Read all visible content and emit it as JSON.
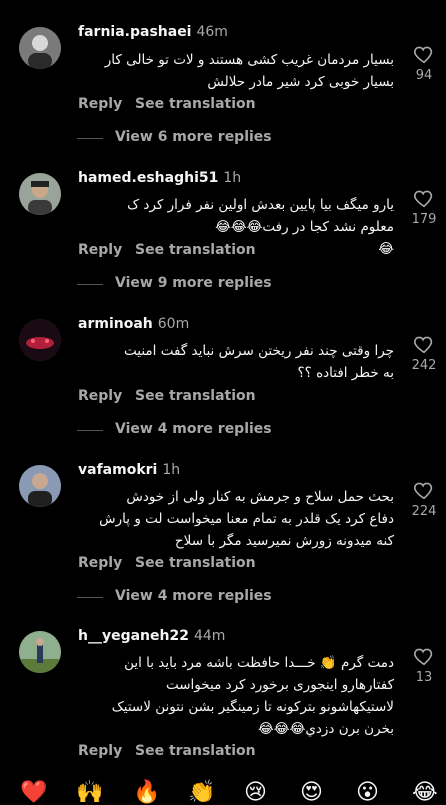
{
  "ui": {
    "reply_label": "Reply",
    "translate_label": "See translation"
  },
  "comments": [
    {
      "username": "farnia.pashaei",
      "time": "46m",
      "lines": [
        "بسیار مردمان غریب کشی هستند و لات تو خالی کار",
        "بسیار خوبی کرد شیر مادر حلالش"
      ],
      "likes": "94",
      "more_replies": "View 6 more replies",
      "avatar_color": "#6b6b6b"
    },
    {
      "username": "hamed.eshaghi51",
      "time": "1h",
      "lines": [
        "یارو میگف بیا پایین بعدش اولین نفر فرار کرد ک",
        "معلوم نشد کجا در رفت😂😂😂",
        "😂"
      ],
      "likes": "179",
      "more_replies": "View 9 more replies",
      "avatar_color": "#556655"
    },
    {
      "username": "arminoah",
      "time": "60m",
      "lines": [
        "چرا وقتی چند نفر ریختن سرش نباید گفت امنیت",
        "به خطر افتاده ؟؟"
      ],
      "likes": "242",
      "more_replies": "View 4 more replies",
      "avatar_color": "#5a1020"
    },
    {
      "username": "vafamokri",
      "time": "1h",
      "lines": [
        "بحث حمل سلاح و جرمش به کنار ولی از خودش",
        "دفاع کرد یک قلدر به تمام معنا میخواست لت و پارش",
        "کنه میدونه زورش نمیرسید مگر با سلاح"
      ],
      "likes": "224",
      "more_replies": "View 4 more replies",
      "avatar_color": "#3a4a66"
    },
    {
      "username": "h__yeganeh22",
      "time": "44m",
      "lines": [
        "دمت گرم 👏 خـــدا حافظت باشه مرد باید با این",
        "کفتارهارو اینجوری برخورد کرد میخواست",
        "لاستیکهاشونو بترکونه تا زمینگیر بشن نتونن لاستیک",
        "بخرن برن دزدي😂😂😂"
      ],
      "likes": "13",
      "more_replies": "",
      "avatar_color": "#5c7a5c"
    }
  ],
  "emoji_bar": [
    "❤️",
    "🙌",
    "🔥",
    "👏",
    "😢",
    "😍",
    "😮",
    "😂"
  ]
}
